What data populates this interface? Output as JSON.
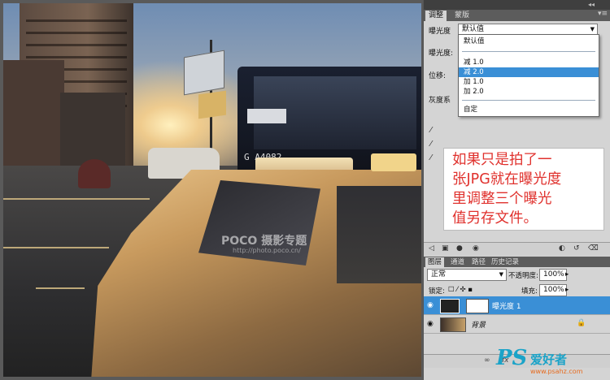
{
  "adjust_panel": {
    "tabs": [
      "调整",
      "蒙版"
    ],
    "exposure_label": "曝光度",
    "preset_value": "默认值",
    "exposure_field_label": "曝光度:",
    "offset_label": "位移:",
    "gamma_label": "灰度系",
    "dropdown": {
      "items": [
        "默认值",
        "减 1.0",
        "减 2.0",
        "加 1.0",
        "加 2.0",
        "自定"
      ],
      "selected": "减 2.0"
    }
  },
  "annotation": {
    "lines": [
      "如果只是拍了一",
      "张JPG就在曝光度",
      "里调整三个曝光",
      "值另存文件。"
    ]
  },
  "layers_panel": {
    "tabs": [
      "图层",
      "通道",
      "路径",
      "历史记录"
    ],
    "blend_mode": "正常",
    "opacity_label": "不透明度:",
    "opacity_value": "100%",
    "lock_label": "锁定:",
    "fill_label": "填充:",
    "fill_value": "100%",
    "layers": [
      {
        "name": "曝光度 1",
        "active": true
      },
      {
        "name": "背景",
        "active": false
      }
    ]
  },
  "photo": {
    "bus_plate": "G A4082",
    "watermark": "POCO 摄影专题",
    "watermark_url": "http://photo.poco.cn/"
  },
  "logo": {
    "ps": "PS",
    "cn": "爱好者",
    "url": "www.psahz.com"
  },
  "colors": {
    "selection": "#3a8fd6",
    "annotation_text": "#e0312d",
    "logo": "#1aa3c8"
  }
}
